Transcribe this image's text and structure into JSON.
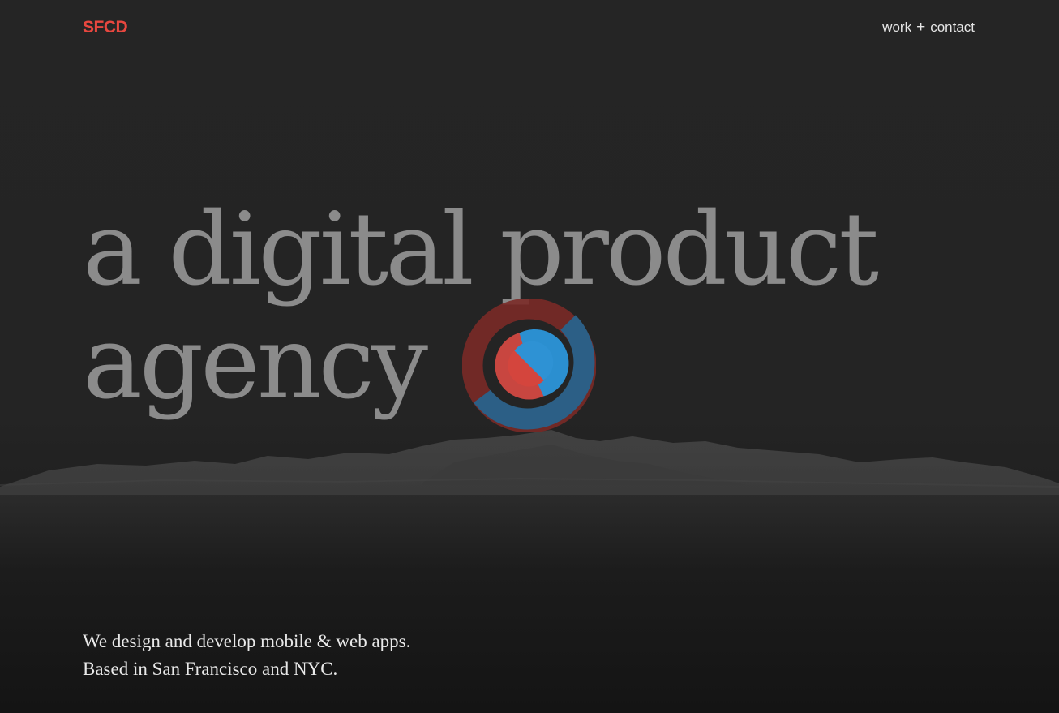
{
  "header": {
    "logo": "SFCD",
    "nav": {
      "work_label": "work",
      "separator": "+",
      "contact_label": "contact"
    }
  },
  "hero": {
    "headline_line1": "a digital product",
    "headline_line2": "agency",
    "tagline_line1": "We design and develop mobile & web apps.",
    "tagline_line2": "Based in San Francisco and NYC."
  },
  "colors": {
    "accent_red": "#e8473f",
    "accent_blue": "#2b8fd0",
    "headline_gray": "#8b8b8b",
    "background": "#232323"
  },
  "icons": {
    "badge": "concentric-rings-logo-icon",
    "background": "mountain-landscape"
  }
}
